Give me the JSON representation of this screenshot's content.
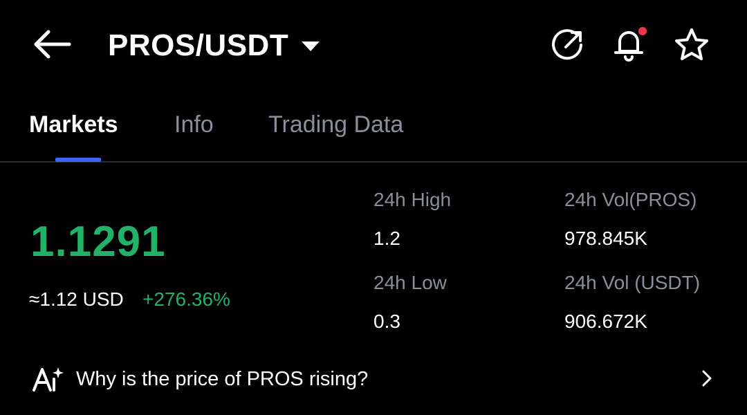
{
  "header": {
    "pair": "PROS/USDT",
    "back_icon": "arrow-left-icon",
    "caret_icon": "caret-down-icon",
    "share_icon": "share-icon",
    "bell_icon": "bell-icon",
    "star_icon": "star-icon",
    "notification_dot_color": "#f0344a"
  },
  "tabs": [
    {
      "label": "Markets",
      "active": true
    },
    {
      "label": "Info",
      "active": false
    },
    {
      "label": "Trading Data",
      "active": false
    }
  ],
  "price": {
    "last": "1.1291",
    "usd": "≈1.12 USD",
    "change": "+276.36%"
  },
  "stats": {
    "high_label": "24h High",
    "high_value": "1.2",
    "low_label": "24h Low",
    "low_value": "0.3",
    "vol_base_label": "24h Vol(PROS)",
    "vol_base_value": "978.845K",
    "vol_quote_label": "24h Vol (USDT)",
    "vol_quote_value": "906.672K"
  },
  "insight": {
    "icon": "ai-sparkle-icon",
    "text": "Why is the price of PROS rising?",
    "chevron_icon": "chevron-right-icon"
  },
  "colors": {
    "background": "#000000",
    "positive": "#22b168",
    "accent": "#3b66f5",
    "muted": "#8a8f99"
  }
}
